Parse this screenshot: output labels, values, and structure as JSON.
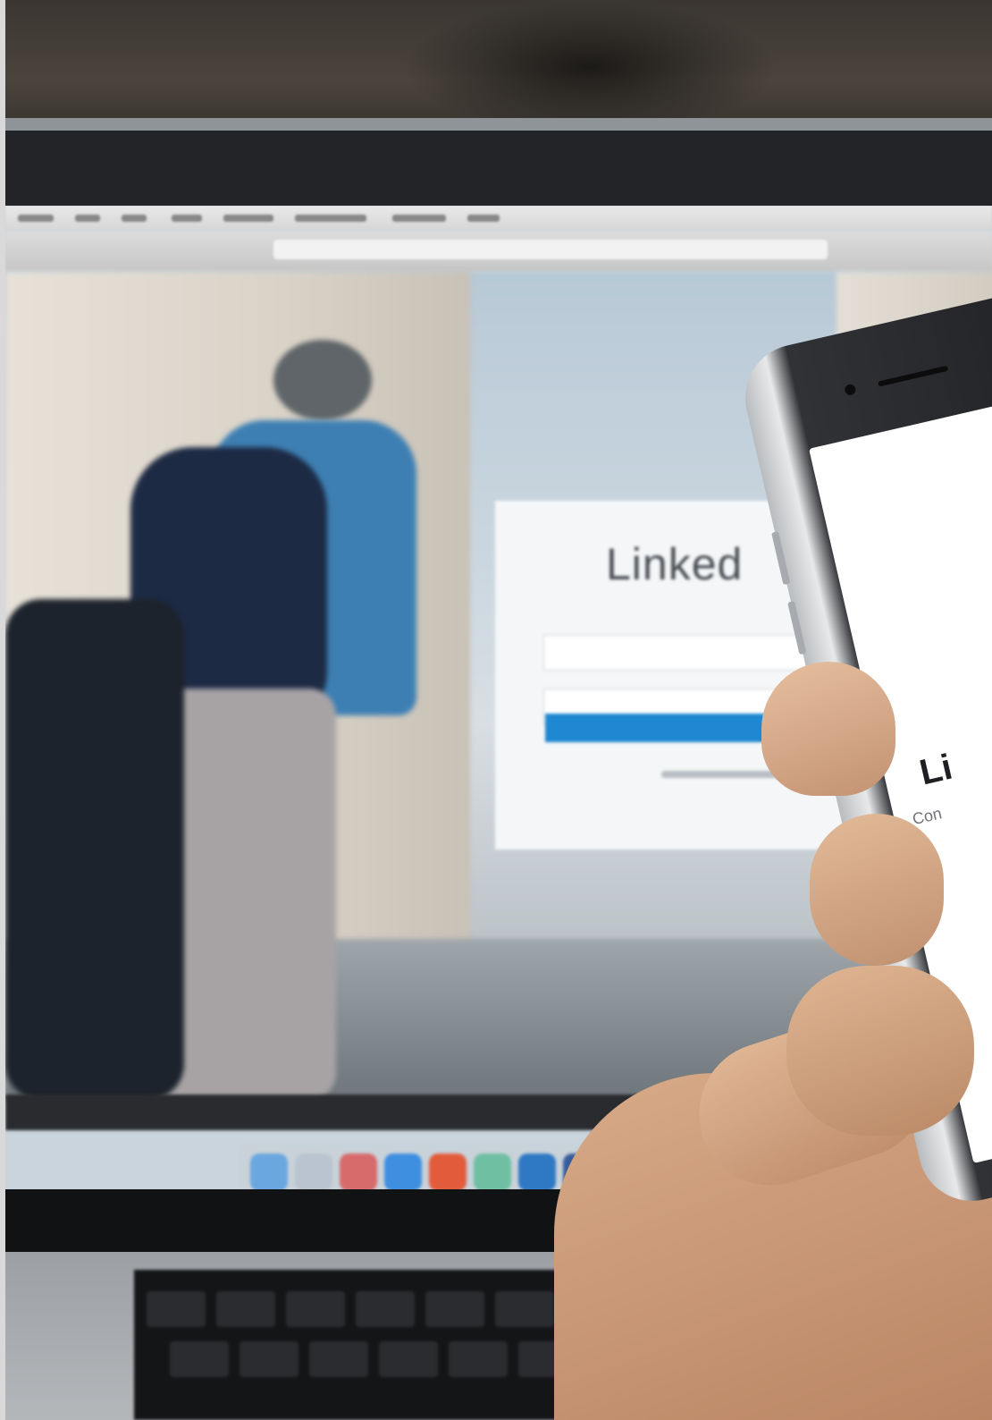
{
  "laptop_screen": {
    "login_logo": "Linked"
  },
  "phone": {
    "app_title": "Li",
    "app_subtitle": "Con"
  },
  "colors": {
    "linkedin_blue": "#1e88d2",
    "laptop_body": "#1b1b1d",
    "phone_screen": "#ffffff"
  }
}
